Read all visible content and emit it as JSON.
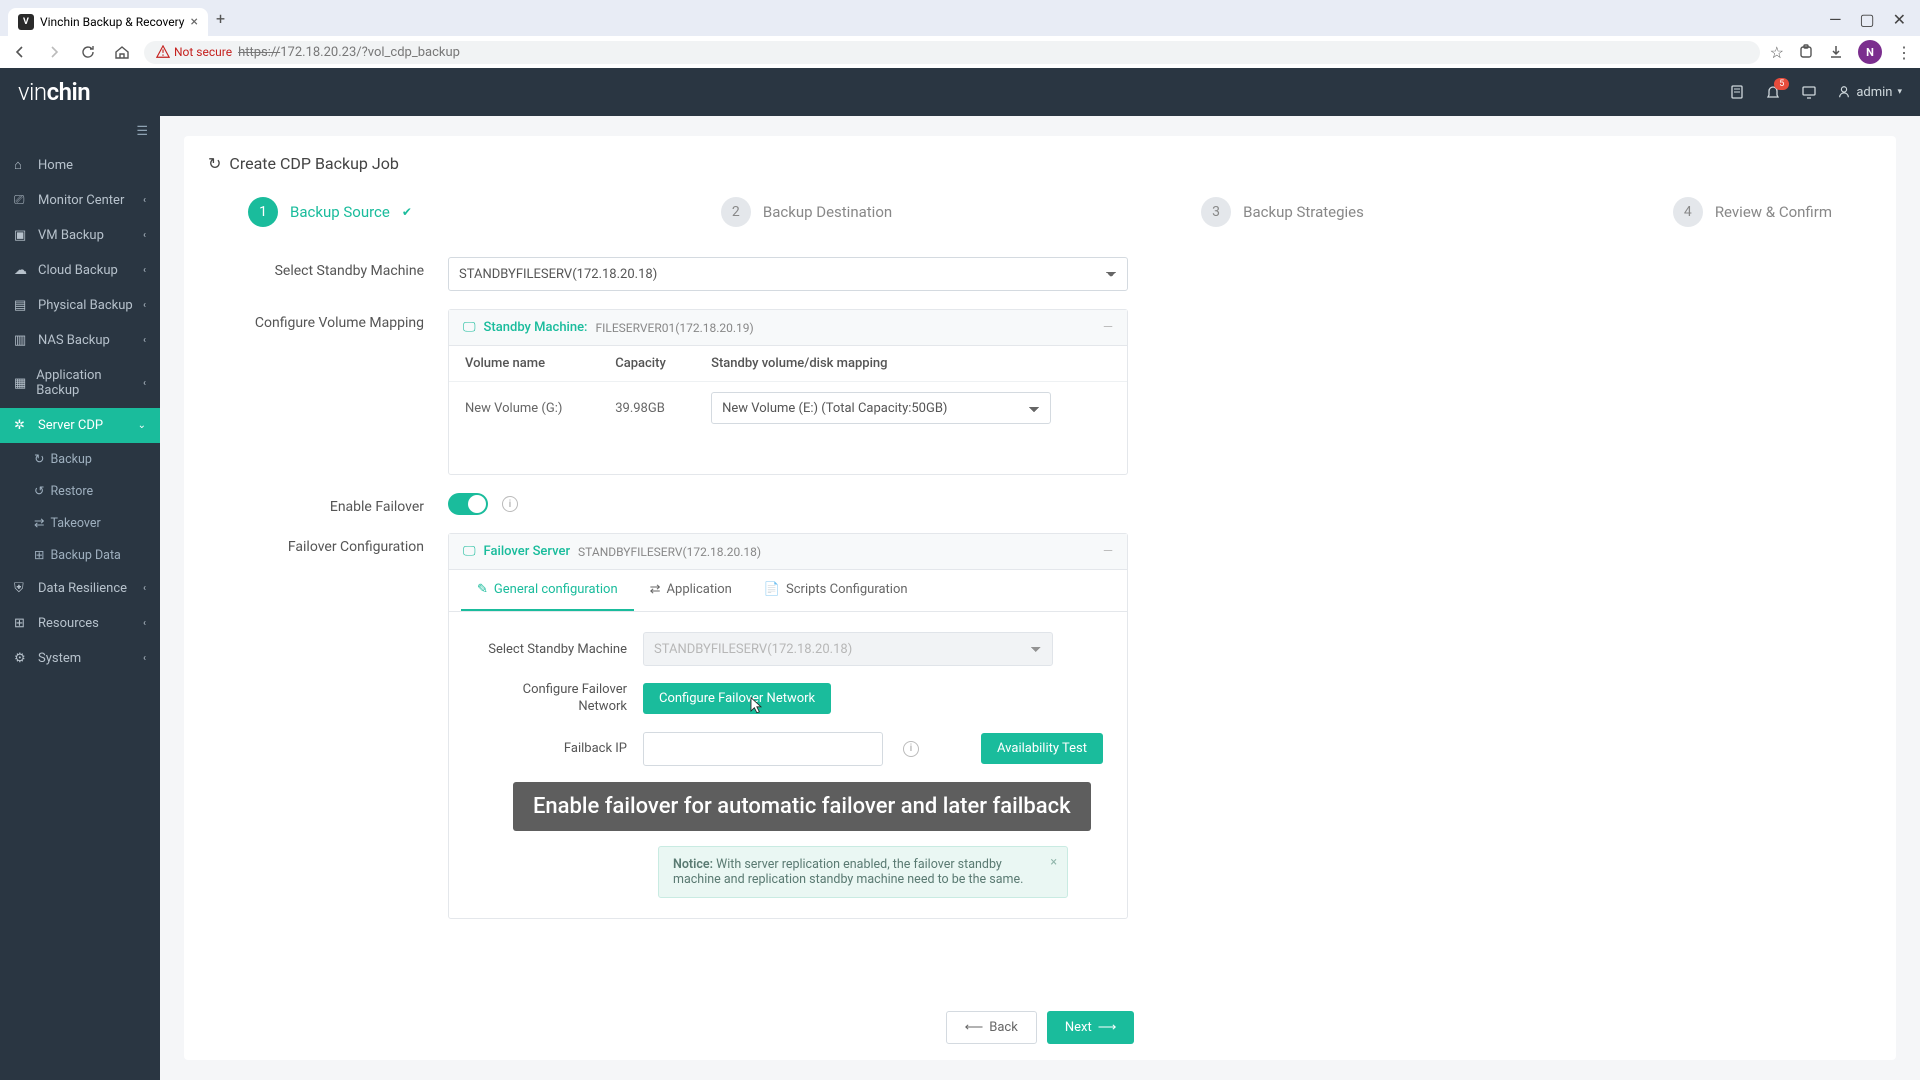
{
  "browser": {
    "tab_title": "Vinchin Backup & Recovery",
    "not_secure": "Not secure",
    "url_scheme": "https://",
    "url_rest": "172.18.20.23/?vol_cdp_backup",
    "avatar_letter": "N"
  },
  "header": {
    "logo_part1": "vin",
    "logo_part2": "chin",
    "notif_count": "5",
    "user": "admin"
  },
  "sidebar": {
    "items": [
      {
        "label": "Home",
        "icon": "home"
      },
      {
        "label": "Monitor Center",
        "icon": "screen",
        "chev": true
      },
      {
        "label": "VM Backup",
        "icon": "cube",
        "chev": true
      },
      {
        "label": "Cloud Backup",
        "icon": "cloud",
        "chev": true
      },
      {
        "label": "Physical Backup",
        "icon": "server",
        "chev": true
      },
      {
        "label": "NAS Backup",
        "icon": "folder",
        "chev": true
      },
      {
        "label": "Application Backup",
        "icon": "app",
        "chev": true
      },
      {
        "label": "Server CDP",
        "icon": "gear",
        "chev": true,
        "active": true
      },
      {
        "label": "Data Resilience",
        "icon": "shield",
        "chev": true
      },
      {
        "label": "Resources",
        "icon": "boxes",
        "chev": true
      },
      {
        "label": "System",
        "icon": "cog",
        "chev": true
      }
    ],
    "cdp_sub": [
      "Backup",
      "Restore",
      "Takeover",
      "Backup Data"
    ]
  },
  "page": {
    "title": "Create CDP Backup Job",
    "steps": [
      {
        "num": "1",
        "label": "Backup Source"
      },
      {
        "num": "2",
        "label": "Backup Destination"
      },
      {
        "num": "3",
        "label": "Backup Strategies"
      },
      {
        "num": "4",
        "label": "Review & Confirm"
      }
    ],
    "select_standby_label": "Select Standby Machine",
    "select_standby_value": "STANDBYFILESERV(172.18.20.18)",
    "configure_volume_label": "Configure Volume Mapping",
    "standby_machine_title": "Standby Machine:",
    "standby_machine_sub": "FILESERVER01(172.18.20.19)",
    "vol_cols": {
      "name": "Volume name",
      "capacity": "Capacity",
      "mapping": "Standby volume/disk mapping"
    },
    "vol_row": {
      "name": "New Volume (G:)",
      "capacity": "39.98GB",
      "mapping": "New Volume (E:) (Total Capacity:50GB)"
    },
    "enable_failover_label": "Enable Failover",
    "failover_config_label": "Failover Configuration",
    "failover_server_title": "Failover Server",
    "failover_server_sub": "STANDBYFILESERV(172.18.20.18)",
    "tabs": {
      "general": "General configuration",
      "application": "Application",
      "scripts": "Scripts Configuration"
    },
    "inner": {
      "select_standby": "Select Standby Machine",
      "select_standby_value": "STANDBYFILESERV(172.18.20.18)",
      "configure_network_label": "Configure Failover Network",
      "configure_network_btn": "Configure Failover Network",
      "failback_ip": "Failback IP",
      "availability_test": "Availability Test"
    },
    "caption": "Enable failover for automatic failover and later failback",
    "notice_title": "Notice:",
    "notice_text": "With server replication enabled, the failover standby machine and replication standby machine need to be the same.",
    "back": "Back",
    "next": "Next"
  }
}
